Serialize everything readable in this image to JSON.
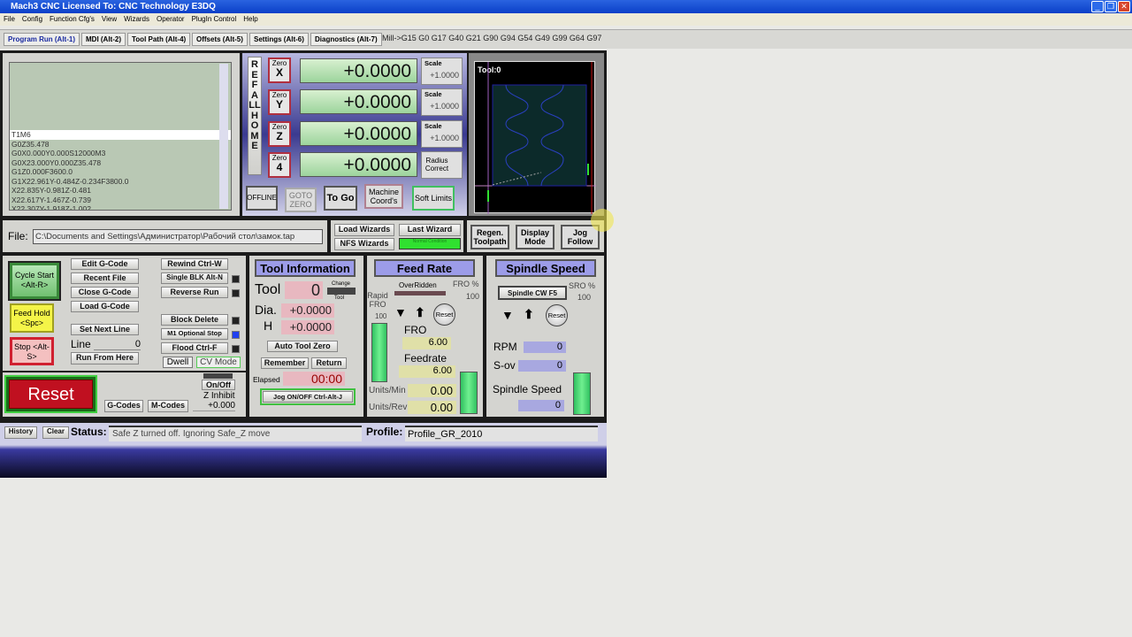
{
  "window": {
    "title": "Mach3 CNC  Licensed To: CNC Technology E3DQ",
    "min": "_",
    "restore": "❐",
    "close": "✕"
  },
  "menu": [
    "File",
    "Config",
    "Function Cfg's",
    "View",
    "Wizards",
    "Operator",
    "PlugIn Control",
    "Help"
  ],
  "tabs": [
    "Program Run (Alt-1)",
    "MDI (Alt-2)",
    "Tool Path (Alt-4)",
    "Offsets (Alt-5)",
    "Settings (Alt-6)",
    "Diagnostics (Alt-7)"
  ],
  "modal_line": "Mill->G15  G0 G17 G40 G21 G90 G94 G54 G49 G99 G64 G97",
  "gcode": [
    "T1M6",
    "G0Z35.478",
    "G0X0.000Y0.000S12000M3",
    "G0X23.000Y0.000Z35.478",
    "G1Z0.000F3600.0",
    "G1X22.961Y-0.484Z-0.234F3800.0",
    "X22.835Y-0.981Z-0.481",
    "X22.617Y-1.467Z-0.739",
    "X22.307Y-1.918Z-1.002"
  ],
  "ref_all_home": "REF ALL HOME",
  "axes": [
    {
      "zero": "Zero",
      "axis": "X",
      "value": "+0.0000",
      "side_label": "Scale",
      "side_value": "+1.0000"
    },
    {
      "zero": "Zero",
      "axis": "Y",
      "value": "+0.0000",
      "side_label": "Scale",
      "side_value": "+1.0000"
    },
    {
      "zero": "Zero",
      "axis": "Z",
      "value": "+0.0000",
      "side_label": "Scale",
      "side_value": "+1.0000"
    },
    {
      "zero": "Zero",
      "axis": "4",
      "value": "+0.0000",
      "side_label": "Radius Correct",
      "side_value": ""
    }
  ],
  "axis_buttons": [
    "OFFLINE",
    "GOTO ZERO",
    "To Go",
    "Machine Coord's",
    "Soft Limits"
  ],
  "toolpath": {
    "label": "Tool:0"
  },
  "file": {
    "label": "File:",
    "value": "C:\\Documents and Settings\\Администратор\\Рабочий стол\\замок.tap"
  },
  "wizards": {
    "load": "Load Wizards",
    "last": "Last Wizard",
    "nfs": "NFS Wizards",
    "normal": "Normal Condition"
  },
  "view_buttons": [
    "Regen. Toolpath",
    "Display Mode",
    "Jog Follow"
  ],
  "program": {
    "cycle_start": "Cycle Start <Alt-R>",
    "feed_hold": "Feed Hold <Spc>",
    "stop": "Stop <Alt-S>",
    "edit": "Edit G-Code",
    "recent": "Recent File",
    "close": "Close G-Code",
    "load": "Load G-Code",
    "set_next": "Set Next Line",
    "line_label": "Line",
    "line_value": "0",
    "run_from": "Run From Here",
    "rewind": "Rewind Ctrl-W",
    "single": "Single BLK Alt-N",
    "reverse": "Reverse Run",
    "block_delete": "Block Delete",
    "m1": "M1 Optional Stop",
    "flood": "Flood Ctrl-F",
    "dwell": "Dwell",
    "cv": "CV Mode",
    "reset": "Reset",
    "gcodes": "G-Codes",
    "mcodes": "M-Codes",
    "onoff": "On/Off",
    "zinhibit": "Z Inhibit",
    "zinhibit_value": "+0.000"
  },
  "tool_info": {
    "title": "Tool Information",
    "tool_label": "Tool",
    "tool_value": "0",
    "change": "Change",
    "change_tool": "Tool",
    "dia_label": "Dia.",
    "dia_value": "+0.0000",
    "h_label": "H",
    "h_value": "+0.0000",
    "auto_zero": "Auto Tool Zero",
    "remember": "Remember",
    "return": "Return",
    "elapsed_label": "Elapsed",
    "elapsed_value": "00:00",
    "jog": "Jog ON/OFF Ctrl-Alt-J"
  },
  "feed": {
    "title": "Feed Rate",
    "overridden": "OverRidden",
    "fro_pct_label": "FRO %",
    "fro_pct": "100",
    "rapid": "Rapid FRO",
    "rapid_value": "100",
    "reset": "Reset",
    "fro_label": "FRO",
    "fro_value": "6.00",
    "feedrate_label": "Feedrate",
    "feedrate_value": "6.00",
    "upm_label": "Units/Min",
    "upm_value": "0.00",
    "upr_label": "Units/Rev",
    "upr_value": "0.00"
  },
  "spindle": {
    "title": "Spindle Speed",
    "cw": "Spindle CW F5",
    "sro_label": "SRO %",
    "sro_value": "100",
    "reset": "Reset",
    "rpm_label": "RPM",
    "rpm_value": "0",
    "sov_label": "S-ov",
    "sov_value": "0",
    "speed_label": "Spindle Speed",
    "speed_value": "0"
  },
  "status": {
    "history": "History",
    "clear": "Clear",
    "label": "Status:",
    "value": "Safe Z turned off. Ignoring Safe_Z move",
    "profile_label": "Profile:",
    "profile_value": "Profile_GR_2010"
  },
  "colors": {
    "titlebar": "#0a3fc8",
    "dro": "#9cd49c",
    "reset": "#c01020",
    "header": "#9c9ce8"
  }
}
